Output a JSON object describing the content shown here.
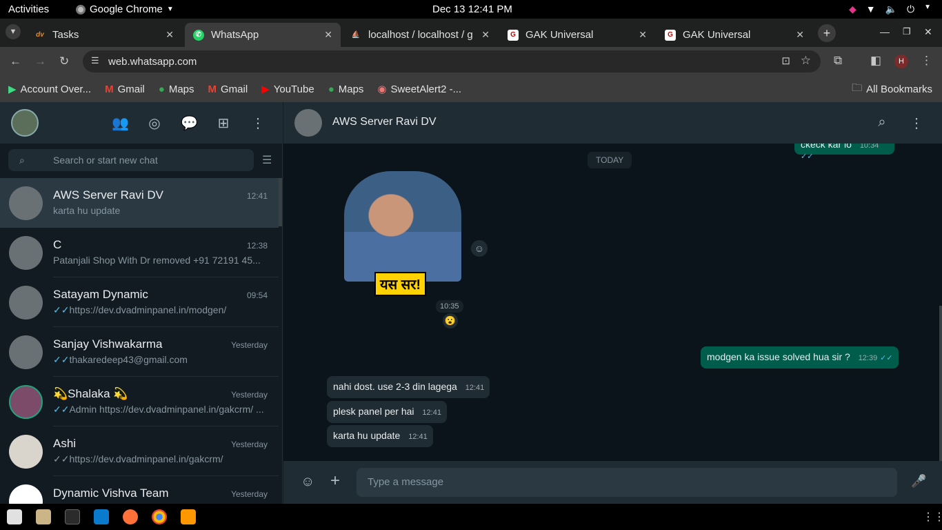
{
  "system": {
    "activities": "Activities",
    "app_name": "Google Chrome",
    "clock": "Dec 13  12:41 PM"
  },
  "tabs": [
    {
      "label": "Tasks",
      "fav": "dv"
    },
    {
      "label": "WhatsApp",
      "fav": "wa"
    },
    {
      "label": "localhost / localhost / g",
      "fav": "pma"
    },
    {
      "label": "GAK Universal",
      "fav": "gak"
    },
    {
      "label": "GAK Universal",
      "fav": "gak"
    }
  ],
  "url": "web.whatsapp.com",
  "bookmarks": [
    "Account Over...",
    "Gmail",
    "Maps",
    "Gmail",
    "YouTube",
    "Maps",
    "SweetAlert2 -..."
  ],
  "all_bookmarks": "All Bookmarks",
  "profile_initial": "H",
  "search_placeholder": "Search or start new chat",
  "chats": [
    {
      "name": "AWS Server Ravi DV",
      "time": "12:41",
      "msg": "karta hu update",
      "ticks": false
    },
    {
      "name": "C",
      "time": "12:38",
      "msg": "Patanjali Shop With Dr removed +91 72191 45...",
      "ticks": false
    },
    {
      "name": "Satayam Dynamic",
      "time": "09:54",
      "msg": "https://dev.dvadminpanel.in/modgen/",
      "ticks": true
    },
    {
      "name": "Sanjay Vishwakarma",
      "time": "Yesterday",
      "msg": "thakaredeep43@gmail.com",
      "ticks": true
    },
    {
      "name": "💫Shalaka 💫",
      "time": "Yesterday",
      "msg": "Admin https://dev.dvadminpanel.in/gakcrm/ ...",
      "ticks": true
    },
    {
      "name": "Ashi",
      "time": "Yesterday",
      "msg": "https://dev.dvadminpanel.in/gakcrm/",
      "ticks": true
    },
    {
      "name": "Dynamic Vishva Team",
      "time": "Yesterday",
      "msg": "",
      "ticks": false
    }
  ],
  "conversation": {
    "title": "AWS Server Ravi DV",
    "top_partial": {
      "text": "ckeck kar lo",
      "time": "10:34"
    },
    "date_chip": "TODAY",
    "sticker": {
      "text": "यस सर!",
      "time": "10:35",
      "reaction": "😮"
    },
    "outgoing": {
      "text": "modgen ka issue solved hua sir ?",
      "time": "12:39"
    },
    "incoming": [
      {
        "text": "nahi dost. use 2-3 din lagega",
        "time": "12:41"
      },
      {
        "text": "plesk panel per hai",
        "time": "12:41"
      },
      {
        "text": "karta hu update",
        "time": "12:41"
      }
    ],
    "composer_placeholder": "Type a message"
  }
}
